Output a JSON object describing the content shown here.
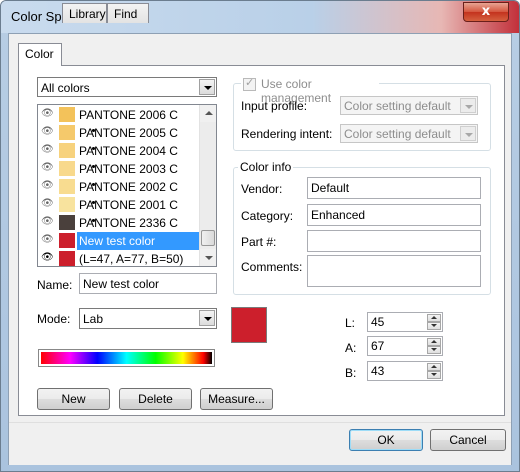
{
  "window": {
    "title": "Color Specs",
    "close_glyph": "x"
  },
  "tabs": [
    {
      "label": "Color"
    },
    {
      "label": "Library"
    },
    {
      "label": "Find"
    }
  ],
  "color_list": {
    "filter": "All colors",
    "items": [
      {
        "label": "PANTONE 2006 C",
        "swatch": "#f3c25a",
        "marker": false
      },
      {
        "label": "PANTONE 2005 C",
        "swatch": "#f5c96b",
        "marker": true
      },
      {
        "label": "PANTONE 2004 C",
        "swatch": "#f7d27d",
        "marker": true
      },
      {
        "label": "PANTONE 2003 C",
        "swatch": "#f8d98c",
        "marker": true
      },
      {
        "label": "PANTONE 2002 C",
        "swatch": "#f8dc90",
        "marker": true
      },
      {
        "label": "PANTONE 2001 C",
        "swatch": "#f8e39e",
        "marker": true
      },
      {
        "label": "PANTONE 2336 C",
        "swatch": "#4a403c",
        "marker": true
      },
      {
        "label": "New test color",
        "swatch": "#cc1f2c",
        "marker": false,
        "selected": true
      },
      {
        "label": "(L=47, A=77, B=50)",
        "swatch": "#cc1f2c",
        "marker": false
      }
    ]
  },
  "name": {
    "label": "Name:",
    "value": "New test color"
  },
  "mode": {
    "label": "Mode:",
    "value": "Lab"
  },
  "preview_color": "#cc1f2c",
  "color_management": {
    "checkbox_label": "Use color management",
    "input_profile_label": "Input profile:",
    "input_profile_value": "Color setting default",
    "rendering_intent_label": "Rendering intent:",
    "rendering_intent_value": "Color setting default"
  },
  "color_info": {
    "title": "Color info",
    "vendor_label": "Vendor:",
    "vendor_value": "Default",
    "category_label": "Category:",
    "category_value": "Enhanced",
    "part_label": "Part #:",
    "part_value": "",
    "comments_label": "Comments:",
    "comments_value": ""
  },
  "lab": {
    "l_label": "L:",
    "l_value": "45",
    "a_label": "A:",
    "a_value": "67",
    "b_label": "B:",
    "b_value": "43"
  },
  "buttons": {
    "new": "New",
    "delete": "Delete",
    "measure": "Measure...",
    "ok": "OK",
    "cancel": "Cancel"
  }
}
